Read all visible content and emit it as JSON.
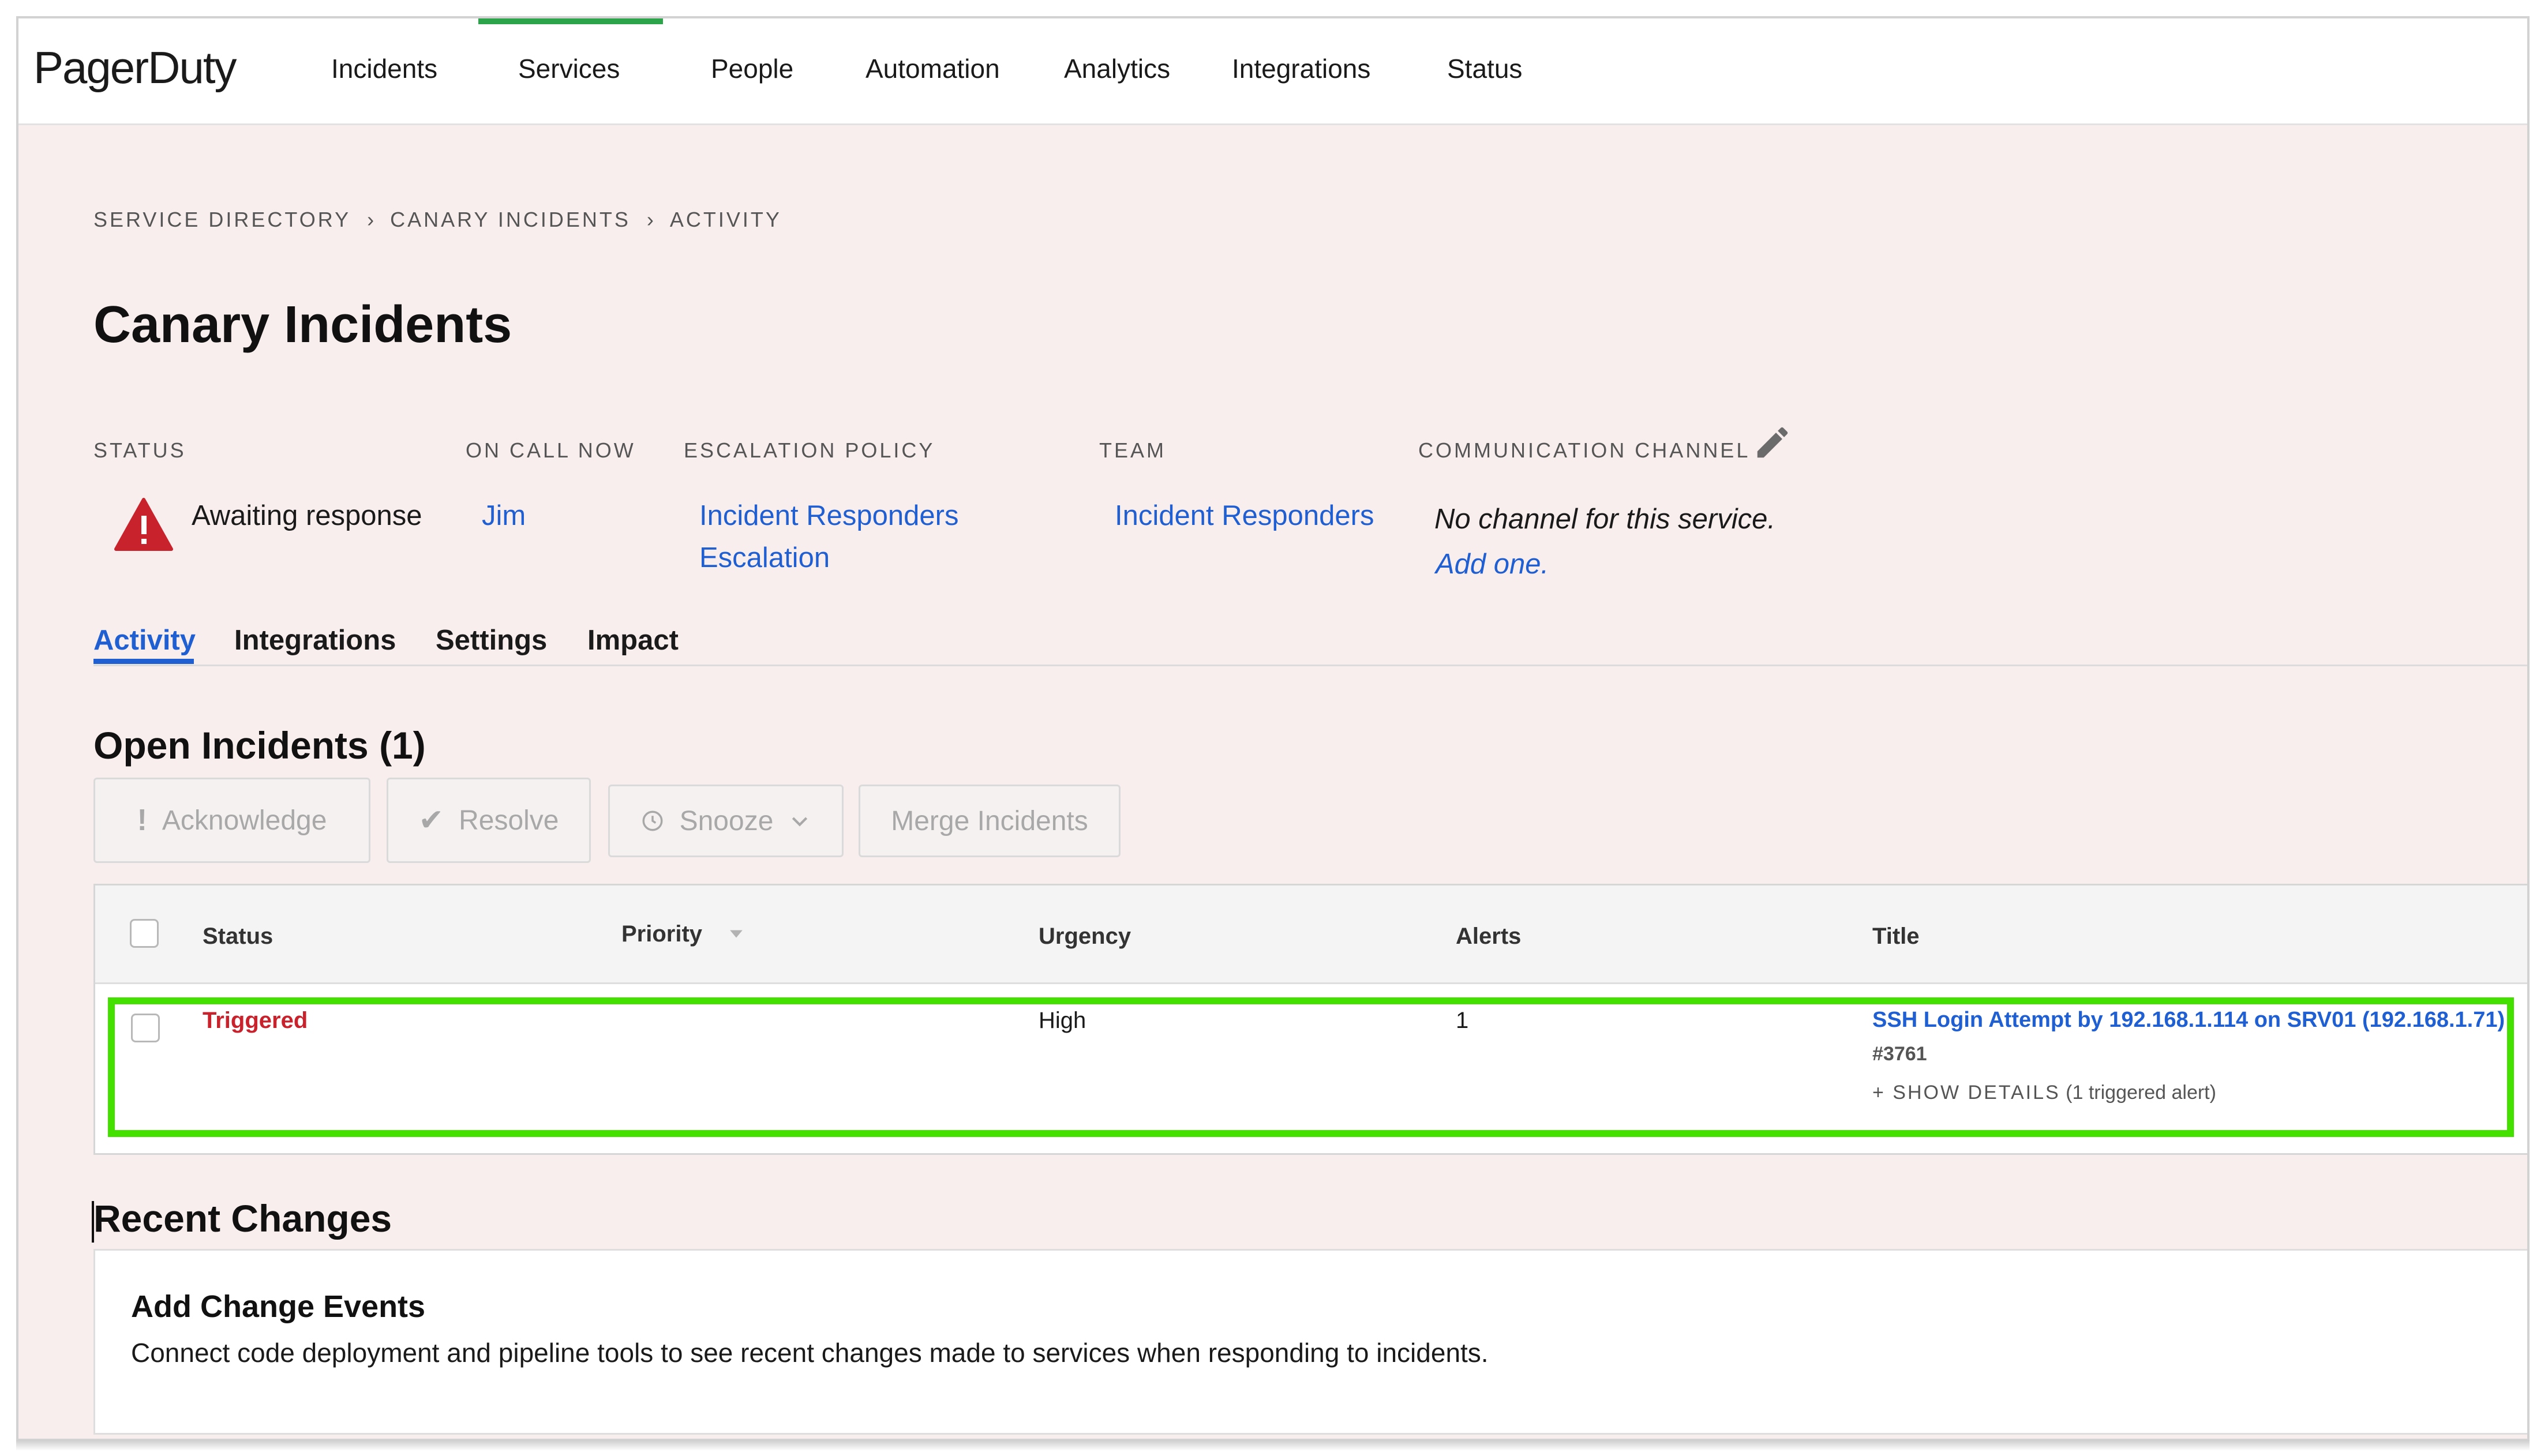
{
  "app": {
    "logo": "PagerDuty",
    "nav": [
      "Incidents",
      "Services",
      "People",
      "Automation",
      "Analytics",
      "Integrations",
      "Status"
    ],
    "active_nav": "Services",
    "accent_color": "#2ca44a",
    "link_color": "#1f5fd1"
  },
  "breadcrumb": [
    "SERVICE DIRECTORY",
    "CANARY INCIDENTS",
    "ACTIVITY"
  ],
  "breadcrumb_separator": "›",
  "page_title": "Canary Incidents",
  "info": {
    "status": {
      "label": "STATUS",
      "value": "Awaiting response",
      "icon": "warning-triangle-icon"
    },
    "on_call": {
      "label": "ON CALL NOW",
      "value": "Jim"
    },
    "escalation": {
      "label": "ESCALATION POLICY",
      "line1": "Incident Responders",
      "line2": "Escalation"
    },
    "team": {
      "label": "TEAM",
      "value": "Incident Responders"
    },
    "channel": {
      "label": "COMMUNICATION CHANNEL",
      "value": "No channel for this service.",
      "link": "Add one."
    }
  },
  "tabs": [
    "Activity",
    "Integrations",
    "Settings",
    "Impact"
  ],
  "active_tab": "Activity",
  "open_incidents": {
    "title": "Open Incidents (1)",
    "buttons": {
      "acknowledge": "Acknowledge",
      "resolve": "Resolve",
      "snooze": "Snooze",
      "merge": "Merge Incidents"
    },
    "columns": [
      "Status",
      "Priority",
      "Urgency",
      "Alerts",
      "Title"
    ],
    "rows": [
      {
        "status": "Triggered",
        "priority": "",
        "urgency": "High",
        "alerts": "1",
        "title": "SSH Login Attempt by 192.168.1.114 on SRV01 (192.168.1.71)",
        "number": "#3761",
        "details_link": "+ SHOW DETAILS",
        "details_note": "(1 triggered alert)"
      }
    ],
    "status_color": "#c8232c",
    "highlight_color": "#44e000"
  },
  "recent_changes": {
    "title": "Recent Changes",
    "card_title": "Add Change Events",
    "card_text": "Connect code deployment and pipeline tools to see recent changes made to services when responding to incidents."
  }
}
